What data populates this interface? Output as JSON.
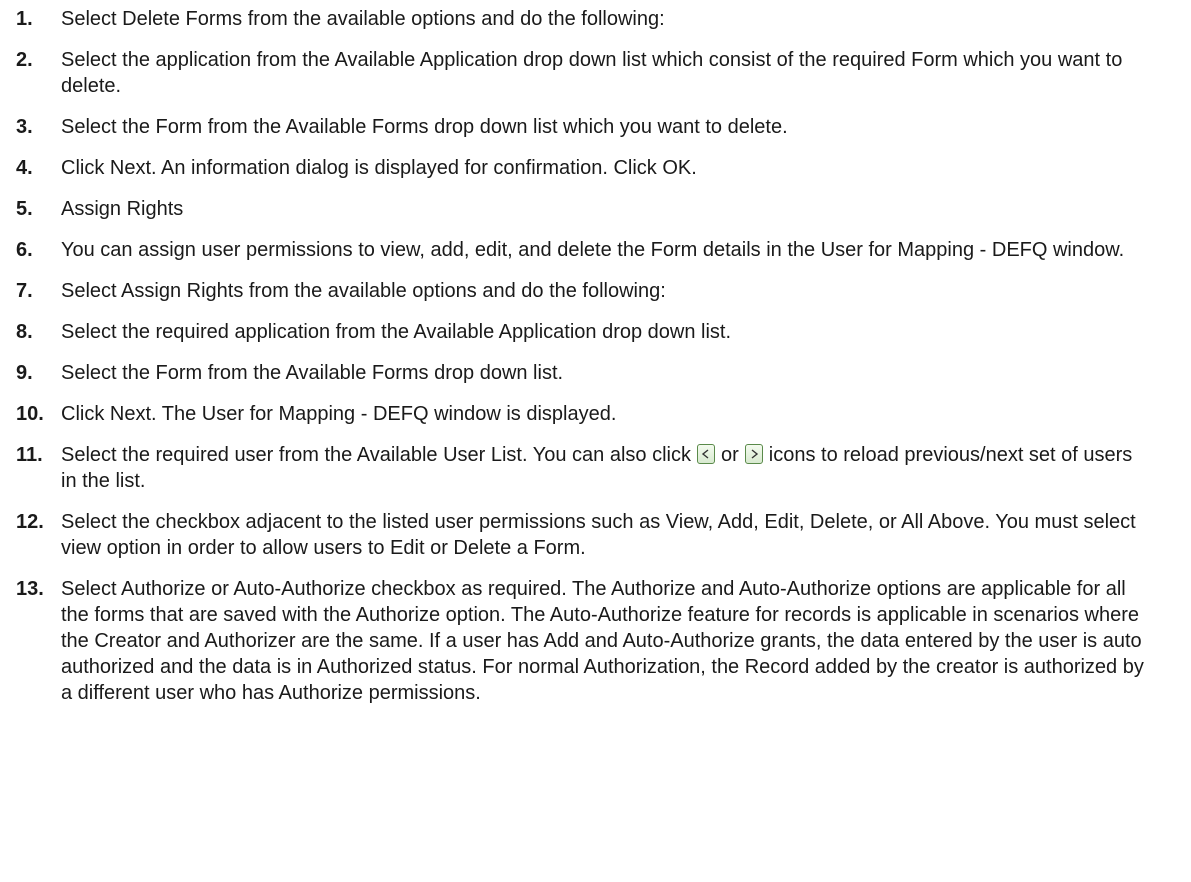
{
  "steps": [
    {
      "num": "1.",
      "text": "Select Delete Forms from the available options and do the following:"
    },
    {
      "num": "2.",
      "text": "Select the application from the Available Application drop down list which consist of the required Form which you want to delete."
    },
    {
      "num": "3.",
      "text": "Select the Form from the Available Forms drop down list which you want to delete."
    },
    {
      "num": "4.",
      "text": "Click Next. An information dialog is displayed for confirmation. Click OK."
    },
    {
      "num": "5.",
      "text": "Assign Rights"
    },
    {
      "num": "6.",
      "text": "You can assign user permissions to view, add, edit, and delete the Form details in the User for Mapping - DEFQ window."
    },
    {
      "num": "7.",
      "text": "Select Assign Rights from the available options and do the following:"
    },
    {
      "num": "8.",
      "text": "Select the required application from the Available Application drop down list."
    },
    {
      "num": "9.",
      "text": "Select the Form from the Available Forms drop down list."
    },
    {
      "num": "10.",
      "text": "Click Next. The User for Mapping - DEFQ window is displayed."
    },
    {
      "num": "11.",
      "text_before": "Select the required user from the Available User List. You can also click",
      "text_or": "or",
      "text_after": "icons to reload previous/next set of users in the list.",
      "icons": [
        "previous-icon",
        "next-icon"
      ]
    },
    {
      "num": "12.",
      "text": "Select the checkbox adjacent to the listed user permissions such as View, Add, Edit, Delete, or All Above. You must select view option in order to allow users to Edit or Delete a Form."
    },
    {
      "num": "13.",
      "text": "Select Authorize or Auto-Authorize checkbox as required. The Authorize and Auto-Authorize options are applicable for all the forms that are saved with the Authorize option. The Auto-Authorize feature for records is applicable in scenarios where the Creator and Authorizer are the same. If a user has Add and Auto-Authorize grants, the data entered by the user is auto authorized and the data is in Authorized status. For normal Authorization, the Record added by the creator is authorized by a different user who has Authorize permissions."
    }
  ]
}
